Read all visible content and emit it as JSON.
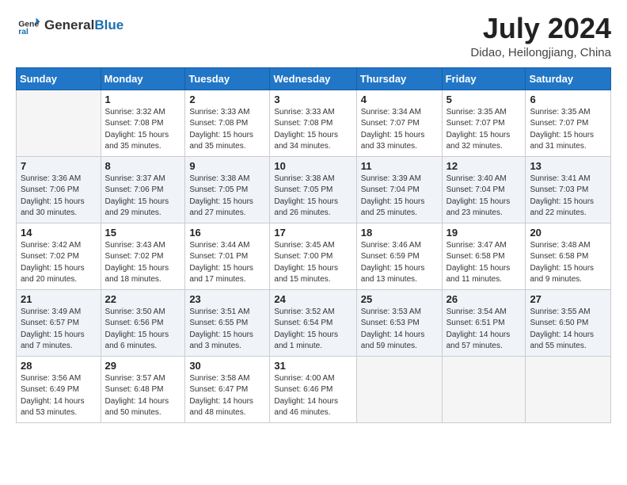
{
  "header": {
    "logo_line1": "General",
    "logo_line2": "Blue",
    "month": "July 2024",
    "location": "Didao, Heilongjiang, China"
  },
  "weekdays": [
    "Sunday",
    "Monday",
    "Tuesday",
    "Wednesday",
    "Thursday",
    "Friday",
    "Saturday"
  ],
  "weeks": [
    [
      {
        "day": "",
        "empty": true
      },
      {
        "day": "1",
        "sunrise": "3:32 AM",
        "sunset": "7:08 PM",
        "daylight": "15 hours and 35 minutes."
      },
      {
        "day": "2",
        "sunrise": "3:33 AM",
        "sunset": "7:08 PM",
        "daylight": "15 hours and 35 minutes."
      },
      {
        "day": "3",
        "sunrise": "3:33 AM",
        "sunset": "7:08 PM",
        "daylight": "15 hours and 34 minutes."
      },
      {
        "day": "4",
        "sunrise": "3:34 AM",
        "sunset": "7:07 PM",
        "daylight": "15 hours and 33 minutes."
      },
      {
        "day": "5",
        "sunrise": "3:35 AM",
        "sunset": "7:07 PM",
        "daylight": "15 hours and 32 minutes."
      },
      {
        "day": "6",
        "sunrise": "3:35 AM",
        "sunset": "7:07 PM",
        "daylight": "15 hours and 31 minutes."
      }
    ],
    [
      {
        "day": "7",
        "sunrise": "3:36 AM",
        "sunset": "7:06 PM",
        "daylight": "15 hours and 30 minutes."
      },
      {
        "day": "8",
        "sunrise": "3:37 AM",
        "sunset": "7:06 PM",
        "daylight": "15 hours and 29 minutes."
      },
      {
        "day": "9",
        "sunrise": "3:38 AM",
        "sunset": "7:05 PM",
        "daylight": "15 hours and 27 minutes."
      },
      {
        "day": "10",
        "sunrise": "3:38 AM",
        "sunset": "7:05 PM",
        "daylight": "15 hours and 26 minutes."
      },
      {
        "day": "11",
        "sunrise": "3:39 AM",
        "sunset": "7:04 PM",
        "daylight": "15 hours and 25 minutes."
      },
      {
        "day": "12",
        "sunrise": "3:40 AM",
        "sunset": "7:04 PM",
        "daylight": "15 hours and 23 minutes."
      },
      {
        "day": "13",
        "sunrise": "3:41 AM",
        "sunset": "7:03 PM",
        "daylight": "15 hours and 22 minutes."
      }
    ],
    [
      {
        "day": "14",
        "sunrise": "3:42 AM",
        "sunset": "7:02 PM",
        "daylight": "15 hours and 20 minutes."
      },
      {
        "day": "15",
        "sunrise": "3:43 AM",
        "sunset": "7:02 PM",
        "daylight": "15 hours and 18 minutes."
      },
      {
        "day": "16",
        "sunrise": "3:44 AM",
        "sunset": "7:01 PM",
        "daylight": "15 hours and 17 minutes."
      },
      {
        "day": "17",
        "sunrise": "3:45 AM",
        "sunset": "7:00 PM",
        "daylight": "15 hours and 15 minutes."
      },
      {
        "day": "18",
        "sunrise": "3:46 AM",
        "sunset": "6:59 PM",
        "daylight": "15 hours and 13 minutes."
      },
      {
        "day": "19",
        "sunrise": "3:47 AM",
        "sunset": "6:58 PM",
        "daylight": "15 hours and 11 minutes."
      },
      {
        "day": "20",
        "sunrise": "3:48 AM",
        "sunset": "6:58 PM",
        "daylight": "15 hours and 9 minutes."
      }
    ],
    [
      {
        "day": "21",
        "sunrise": "3:49 AM",
        "sunset": "6:57 PM",
        "daylight": "15 hours and 7 minutes."
      },
      {
        "day": "22",
        "sunrise": "3:50 AM",
        "sunset": "6:56 PM",
        "daylight": "15 hours and 6 minutes."
      },
      {
        "day": "23",
        "sunrise": "3:51 AM",
        "sunset": "6:55 PM",
        "daylight": "15 hours and 3 minutes."
      },
      {
        "day": "24",
        "sunrise": "3:52 AM",
        "sunset": "6:54 PM",
        "daylight": "15 hours and 1 minute."
      },
      {
        "day": "25",
        "sunrise": "3:53 AM",
        "sunset": "6:53 PM",
        "daylight": "14 hours and 59 minutes."
      },
      {
        "day": "26",
        "sunrise": "3:54 AM",
        "sunset": "6:51 PM",
        "daylight": "14 hours and 57 minutes."
      },
      {
        "day": "27",
        "sunrise": "3:55 AM",
        "sunset": "6:50 PM",
        "daylight": "14 hours and 55 minutes."
      }
    ],
    [
      {
        "day": "28",
        "sunrise": "3:56 AM",
        "sunset": "6:49 PM",
        "daylight": "14 hours and 53 minutes."
      },
      {
        "day": "29",
        "sunrise": "3:57 AM",
        "sunset": "6:48 PM",
        "daylight": "14 hours and 50 minutes."
      },
      {
        "day": "30",
        "sunrise": "3:58 AM",
        "sunset": "6:47 PM",
        "daylight": "14 hours and 48 minutes."
      },
      {
        "day": "31",
        "sunrise": "4:00 AM",
        "sunset": "6:46 PM",
        "daylight": "14 hours and 46 minutes."
      },
      {
        "day": "",
        "empty": true
      },
      {
        "day": "",
        "empty": true
      },
      {
        "day": "",
        "empty": true
      }
    ]
  ]
}
